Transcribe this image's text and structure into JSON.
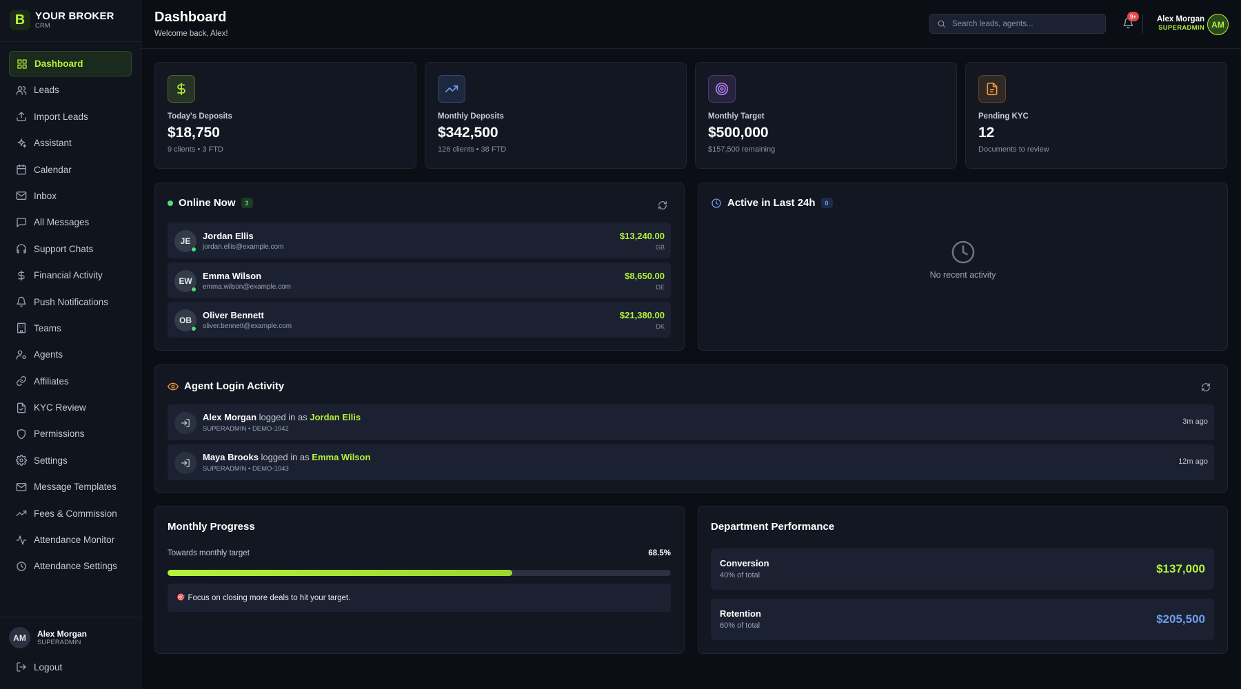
{
  "brand": {
    "logo_letter": "B",
    "name": "YOUR BROKER",
    "sub": "CRM"
  },
  "nav": [
    {
      "label": "Dashboard",
      "icon": "dashboard-icon",
      "active": true
    },
    {
      "label": "Leads",
      "icon": "users-icon"
    },
    {
      "label": "Import Leads",
      "icon": "upload-icon"
    },
    {
      "label": "Assistant",
      "icon": "sparkles-icon"
    },
    {
      "label": "Calendar",
      "icon": "calendar-icon"
    },
    {
      "label": "Inbox",
      "icon": "mail-icon"
    },
    {
      "label": "All Messages",
      "icon": "message-square-icon"
    },
    {
      "label": "Support Chats",
      "icon": "headset-icon"
    },
    {
      "label": "Financial Activity",
      "icon": "dollar-icon"
    },
    {
      "label": "Push Notifications",
      "icon": "bell-icon"
    },
    {
      "label": "Teams",
      "icon": "building-icon"
    },
    {
      "label": "Agents",
      "icon": "user-cog-icon"
    },
    {
      "label": "Affiliates",
      "icon": "link-icon"
    },
    {
      "label": "KYC Review",
      "icon": "file-check-icon"
    },
    {
      "label": "Permissions",
      "icon": "shield-icon"
    },
    {
      "label": "Settings",
      "icon": "gear-icon"
    },
    {
      "label": "Message Templates",
      "icon": "mail-icon"
    },
    {
      "label": "Fees & Commission",
      "icon": "trending-up-icon"
    },
    {
      "label": "Attendance Monitor",
      "icon": "activity-icon"
    },
    {
      "label": "Attendance Settings",
      "icon": "clock-icon"
    }
  ],
  "sidebar_user": {
    "initials": "AM",
    "name": "Alex Morgan",
    "role": "SUPERADMIN"
  },
  "logout_label": "Logout",
  "header": {
    "title": "Dashboard",
    "subtitle": "Welcome back, Alex!",
    "search_placeholder": "Search leads, agents...",
    "notifications_badge": "9+",
    "user_name": "Alex Morgan",
    "user_role": "SUPERADMIN",
    "user_initials": "AM"
  },
  "stats": [
    {
      "label": "Today's Deposits",
      "value": "$18,750",
      "sub": "9 clients • 3 FTD",
      "icon": "dollar-icon",
      "accent": "#b5f23a"
    },
    {
      "label": "Monthly Deposits",
      "value": "$342,500",
      "sub": "126 clients • 38 FTD",
      "icon": "trending-up-icon",
      "accent": "#6f9cf0"
    },
    {
      "label": "Monthly Target",
      "value": "$500,000",
      "sub": "$157,500 remaining",
      "icon": "target-icon",
      "accent": "#b07cf0"
    },
    {
      "label": "Pending KYC",
      "value": "12",
      "sub": "Documents to review",
      "icon": "file-icon",
      "accent": "#f09a3e"
    }
  ],
  "online_now": {
    "title": "Online Now",
    "count": "3",
    "clients": [
      {
        "initials": "JE",
        "name": "Jordan Ellis",
        "email": "jordan.ellis@example.com",
        "amount": "$13,240.00",
        "country": "GB"
      },
      {
        "initials": "EW",
        "name": "Emma Wilson",
        "email": "emma.wilson@example.com",
        "amount": "$8,650.00",
        "country": "DE"
      },
      {
        "initials": "OB",
        "name": "Oliver Bennett",
        "email": "oliver.bennett@example.com",
        "amount": "$21,380.00",
        "country": "DK"
      }
    ]
  },
  "active_24h": {
    "title": "Active in Last 24h",
    "count": "0",
    "empty_text": "No recent activity"
  },
  "agent_login": {
    "title": "Agent Login Activity",
    "logged_in_as": "logged in as",
    "entries": [
      {
        "agent": "Alex Morgan",
        "target": "Jordan Ellis",
        "meta": "SUPERADMIN • DEMO-1042",
        "ago": "3m ago"
      },
      {
        "agent": "Maya Brooks",
        "target": "Emma Wilson",
        "meta": "SUPERADMIN • DEMO-1043",
        "ago": "12m ago"
      }
    ]
  },
  "monthly_progress": {
    "title": "Monthly Progress",
    "label": "Towards monthly target",
    "percent_text": "68.5%",
    "percent": 68.5,
    "tip_emoji": "🎯",
    "tip": "Focus on closing more deals to hit your target."
  },
  "department": {
    "title": "Department Performance",
    "rows": [
      {
        "name": "Conversion",
        "pct": "40% of total",
        "value": "$137,000",
        "color": "#b5f23a"
      },
      {
        "name": "Retention",
        "pct": "60% of total",
        "value": "$205,500",
        "color": "#6f9cf0"
      }
    ]
  }
}
